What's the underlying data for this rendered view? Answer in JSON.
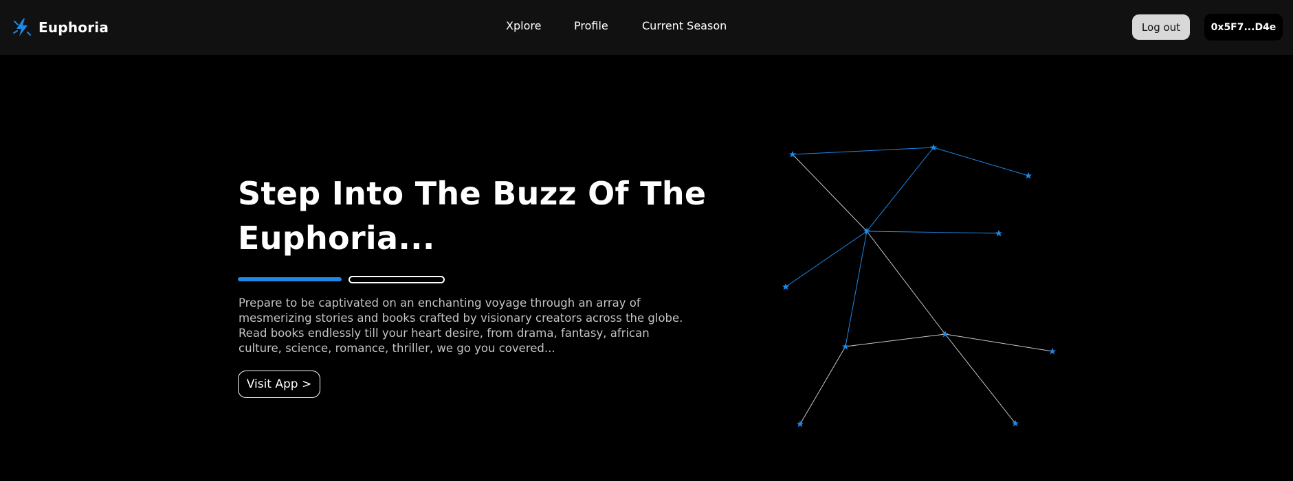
{
  "nav": {
    "brand": {
      "name": "Euphoria",
      "icon": "bolt-icon"
    },
    "links": [
      {
        "label": "Xplore"
      },
      {
        "label": "Profile"
      },
      {
        "label": "Current Season"
      }
    ],
    "logout_label": "Log out",
    "wallet_address": "0x5F7...D4e"
  },
  "hero": {
    "title": "Step Into The Buzz Of The Euphoria...",
    "description": "Prepare to be captivated on an enchanting voyage through an array of mesmerizing stories and books crafted by visionary creators across the globe. Read books endlessly till your heart desire, from drama, fantasy, african culture, science, romance, thriller, we go you covered...",
    "cta_label": "Visit App >",
    "progress": {
      "active_segment": 1,
      "total_segments": 2
    }
  },
  "theme": {
    "accent": "#1e88e5",
    "background": "#000000",
    "topbar": "#111111"
  },
  "illustration": {
    "icon": "star-constellation-icon"
  }
}
